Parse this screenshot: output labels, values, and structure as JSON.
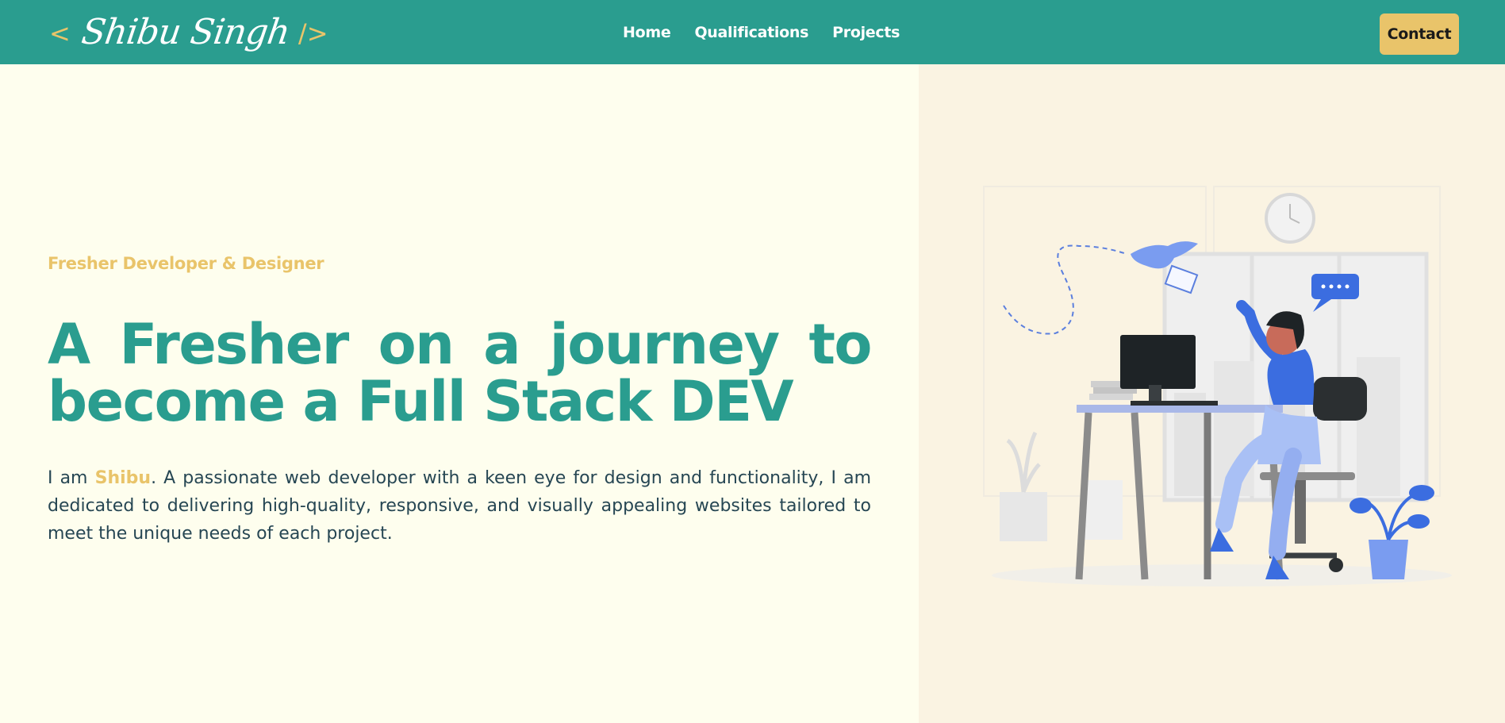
{
  "nav": {
    "logo": {
      "open_bracket": "<",
      "name": "Shibu Singh",
      "close_bracket": "/>"
    },
    "links": [
      "Home",
      "Qualifications",
      "Projects"
    ],
    "contact_label": "Contact"
  },
  "hero": {
    "tagline": "Fresher Developer & Designer",
    "headline": "A Fresher on a journey to become a Full Stack DEV",
    "intro_prefix": "I am ",
    "intro_name": "Shibu",
    "intro_rest": ". A passionate web developer with a keen eye for design and functionality, I am dedicated to delivering high-quality, responsive, and visually appealing websites tailored to meet the unique needs of each project."
  },
  "colors": {
    "primary": "#2a9d8f",
    "accent": "#e9c46a",
    "text": "#264653",
    "page_bg": "#fefeee",
    "panel_bg": "#faf3e2"
  }
}
